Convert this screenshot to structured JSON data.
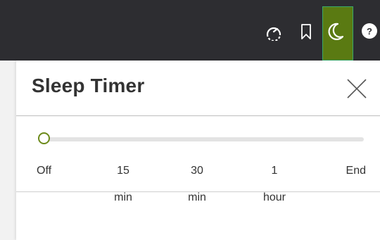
{
  "topbar": {
    "icons": [
      "speedometer-icon",
      "bookmark-icon",
      "moon-icon",
      "help-icon"
    ],
    "help_glyph": "?",
    "active_color": "#5a7a12",
    "bg_color": "#2d2d31"
  },
  "panel": {
    "title": "Sleep Timer",
    "close_icon": "close-icon",
    "slider": {
      "selected": "Off",
      "stops": [
        {
          "line1": "Off",
          "line2": ""
        },
        {
          "line1": "15",
          "line2": "min"
        },
        {
          "line1": "30",
          "line2": "min"
        },
        {
          "line1": "1",
          "line2": "hour"
        },
        {
          "line1": "End",
          "line2": ""
        }
      ],
      "accent_color": "#6c8a1a"
    }
  }
}
